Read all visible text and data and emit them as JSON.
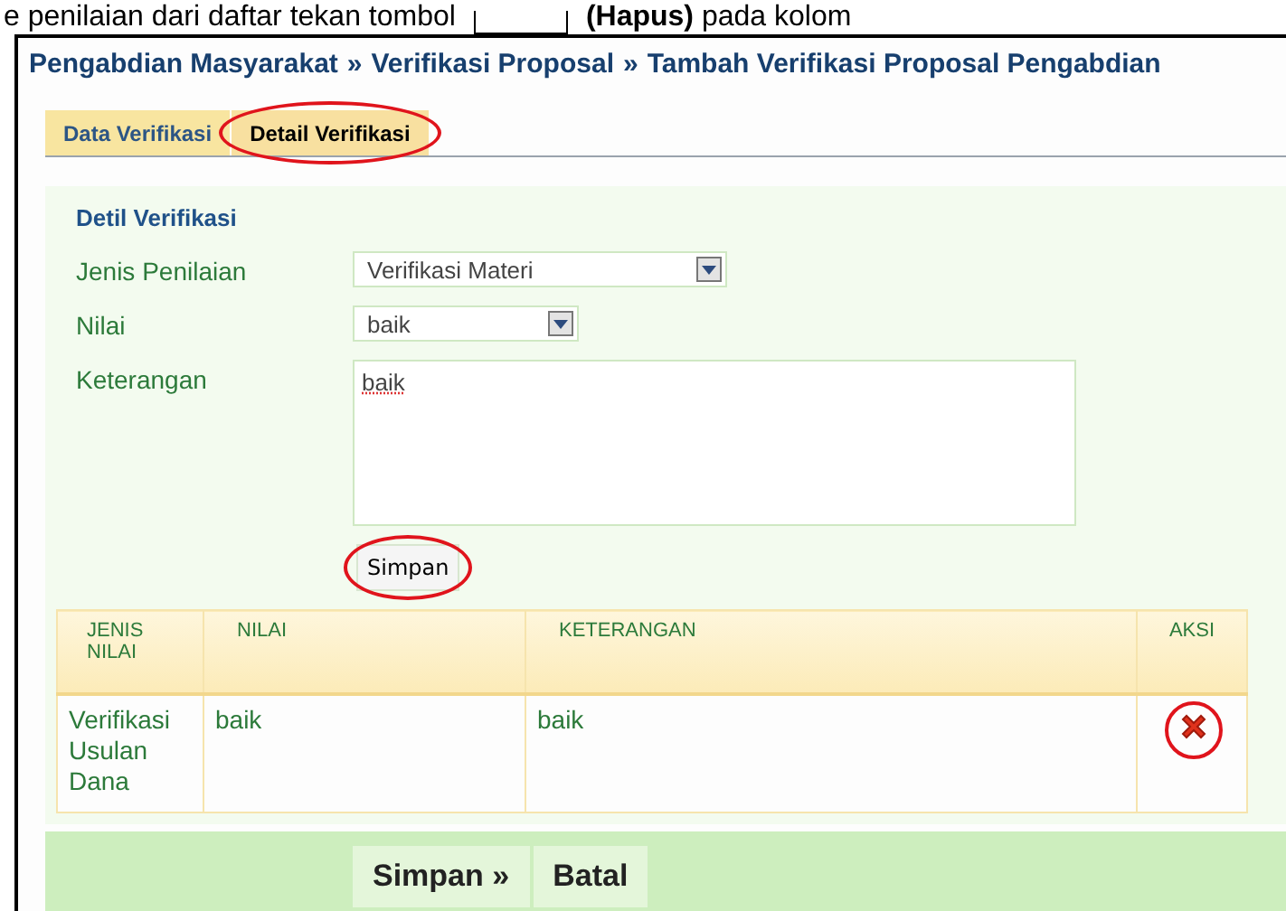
{
  "document_text": {
    "before": "e penilaian dari daftar tekan tombol",
    "after": "**(Hapus)** pada kolom"
  },
  "breadcrumb": [
    "Pengabdian Masyarakat",
    "»",
    "Verifikasi Proposal",
    "»",
    "Tambah Verifikasi Proposal Pengabdian"
  ],
  "tabs": [
    {
      "label": "Data Verifikasi",
      "selected": false,
      "annotated": false
    },
    {
      "label": "Detail Verifikasi",
      "selected": true,
      "annotated": true
    }
  ],
  "form": {
    "title": "Detil Verifikasi",
    "fields": [
      {
        "kind": "select",
        "label": "Jenis Penilaian",
        "value": "Verifikasi Materi"
      },
      {
        "kind": "select",
        "label": "Nilai",
        "value": "baik"
      },
      {
        "kind": "textarea",
        "label": "Keterangan",
        "value": "baik"
      }
    ],
    "button": {
      "label": "Simpan",
      "annotated": true
    }
  },
  "table": {
    "columns": [
      "JENIS NILAI",
      "NILAI",
      "KETERANGAN",
      "AKSI"
    ],
    "rows": [
      {
        "cells": [
          "Verifikasi Usulan Dana",
          "baik",
          "baik"
        ],
        "delete_annotated": true
      }
    ]
  },
  "footer_buttons": [
    "Simpan »",
    "Batal"
  ]
}
